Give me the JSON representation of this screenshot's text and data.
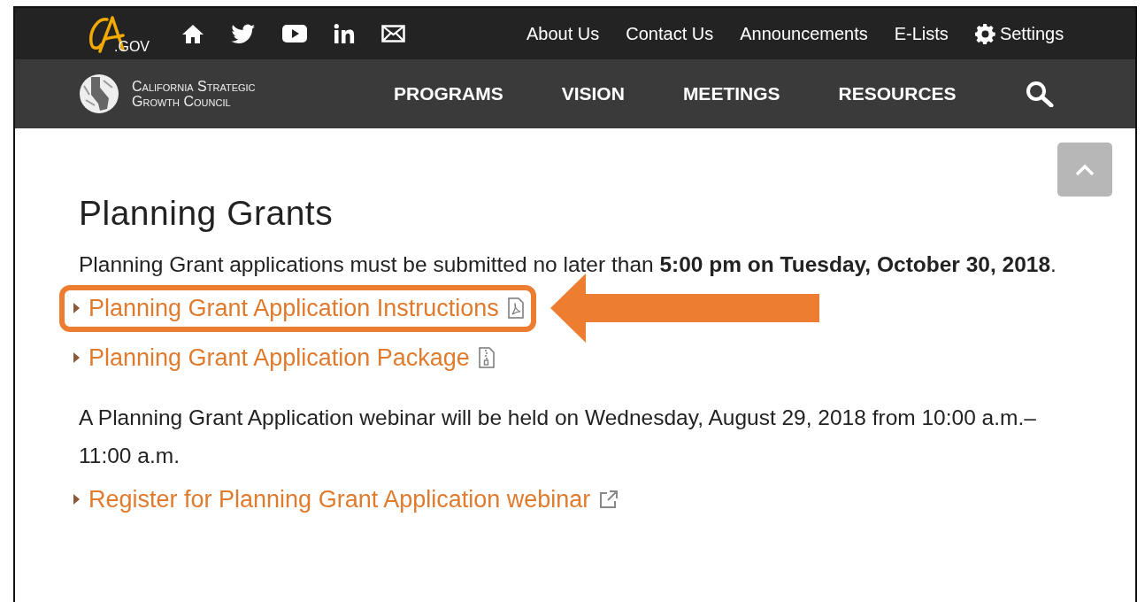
{
  "header": {
    "logo": {
      "text": ".GOV"
    },
    "utility_links": [
      {
        "label": "About Us",
        "kind": "link"
      },
      {
        "label": "Contact Us",
        "kind": "link"
      },
      {
        "label": "Announcements",
        "kind": "link"
      },
      {
        "label": "E-Lists",
        "kind": "link"
      },
      {
        "label": "Settings",
        "kind": "settings"
      }
    ],
    "site_name": [
      "California Strategic",
      "Growth Council"
    ],
    "nav": [
      "PROGRAMS",
      "VISION",
      "MEETINGS",
      "RESOURCES"
    ]
  },
  "content": {
    "heading": "Planning Grants",
    "intro": "Planning Grant applications must be submitted no later than **5:00 pm on Tuesday, October 30, 2018**.",
    "links": [
      {
        "label": "Planning Grant Application Instructions",
        "kind": "pdf",
        "highlighted": true
      },
      {
        "label": "Planning Grant Application Package",
        "kind": "zip",
        "highlighted": false
      }
    ],
    "webinar_text": "A Planning Grant Application webinar will be held on Wednesday, August 29, 2018 from 10:00 a.m.–11:00 a.m.",
    "webinar_links": [
      {
        "label": "Register for Planning Grant Application webinar",
        "kind": "external",
        "highlighted": false
      }
    ]
  }
}
